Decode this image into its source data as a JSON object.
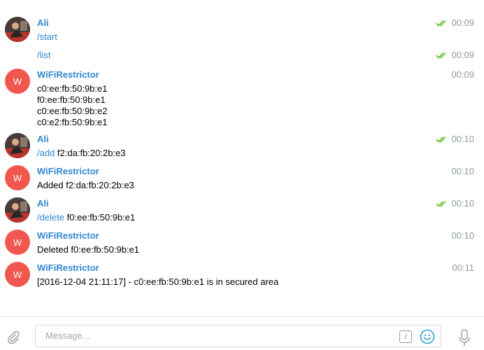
{
  "messages": [
    {
      "sender": "Ali",
      "avatar": "user-photo",
      "parts": [
        [
          {
            "text": "/start",
            "cmd": true
          }
        ]
      ],
      "time": "00:09",
      "read": true
    },
    {
      "sender": "",
      "avatar": "",
      "parts": [
        [
          {
            "text": "/list",
            "cmd": true
          }
        ]
      ],
      "time": "00:09",
      "read": true
    },
    {
      "sender": "WiFiRestrictor",
      "avatar": "W",
      "parts": [
        [
          {
            "text": "c0:ee:fb:50:9b:e1",
            "cmd": false
          }
        ],
        [
          {
            "text": "f0:ee:fb:50:9b:e1",
            "cmd": false
          }
        ],
        [
          {
            "text": "c0:ee:fb:50:9b:e2",
            "cmd": false
          }
        ],
        [
          {
            "text": "c0:e2:fb:50:9b:e1",
            "cmd": false
          }
        ]
      ],
      "time": "00:09",
      "read": false
    },
    {
      "sender": "Ali",
      "avatar": "user-photo",
      "parts": [
        [
          {
            "text": "/add",
            "cmd": true
          },
          {
            "text": " f2:da:fb:20:2b:e3",
            "cmd": false
          }
        ]
      ],
      "time": "00:10",
      "read": true
    },
    {
      "sender": "WiFiRestrictor",
      "avatar": "W",
      "parts": [
        [
          {
            "text": "Added f2:da:fb:20:2b:e3",
            "cmd": false
          }
        ]
      ],
      "time": "00:10",
      "read": false
    },
    {
      "sender": "Ali",
      "avatar": "user-photo",
      "parts": [
        [
          {
            "text": "/delete",
            "cmd": true
          },
          {
            "text": " f0:ee:fb:50:9b:e1",
            "cmd": false
          }
        ]
      ],
      "time": "00:10",
      "read": true
    },
    {
      "sender": "WiFiRestrictor",
      "avatar": "W",
      "parts": [
        [
          {
            "text": "Deleted f0:ee:fb:50:9b:e1",
            "cmd": false
          }
        ]
      ],
      "time": "00:10",
      "read": false
    },
    {
      "sender": "WiFiRestrictor",
      "avatar": "W",
      "parts": [
        [
          {
            "text": "[2016-12-04 21:11:17] - c0:ee:fb:50:9b:e1 is in secured area",
            "cmd": false
          }
        ]
      ],
      "time": "00:11",
      "read": false
    }
  ],
  "composer": {
    "placeholder": "Message...",
    "slash_label": "/"
  },
  "icons": {
    "attach": "paperclip-icon",
    "emoji": "smiley-icon",
    "mic": "microphone-icon",
    "read": "double-check-icon"
  },
  "colors": {
    "accent": "#2f88cf",
    "bot_avatar": "#f1574f",
    "read_check": "#4cbb17",
    "time": "#8e9aa6"
  }
}
